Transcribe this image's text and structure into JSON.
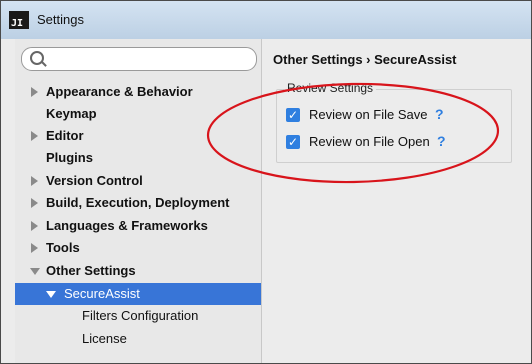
{
  "window": {
    "title": "Settings",
    "app_icon_text": "JI"
  },
  "search": {
    "placeholder": "",
    "value": ""
  },
  "sidebar": {
    "items": [
      {
        "label": "Appearance & Behavior",
        "arrow": "right"
      },
      {
        "label": "Keymap",
        "arrow": "none"
      },
      {
        "label": "Editor",
        "arrow": "right"
      },
      {
        "label": "Plugins",
        "arrow": "none"
      },
      {
        "label": "Version Control",
        "arrow": "right"
      },
      {
        "label": "Build, Execution, Deployment",
        "arrow": "right"
      },
      {
        "label": "Languages & Frameworks",
        "arrow": "right"
      },
      {
        "label": "Tools",
        "arrow": "right"
      },
      {
        "label": "Other Settings",
        "arrow": "down"
      },
      {
        "label": "SecureAssist",
        "arrow": "down",
        "selected": true
      },
      {
        "label": "Filters Configuration",
        "arrow": "none"
      },
      {
        "label": "License",
        "arrow": "none"
      }
    ]
  },
  "content": {
    "breadcrumb": "Other Settings › SecureAssist",
    "group_title": "Review Settings",
    "options": [
      {
        "label": "Review on File Save",
        "checked": true,
        "help": "?"
      },
      {
        "label": "Review on File Open",
        "checked": true,
        "help": "?"
      }
    ]
  },
  "colors": {
    "selection": "#3875d7",
    "checkbox": "#2f7fe0",
    "annotation": "#d8141b"
  }
}
